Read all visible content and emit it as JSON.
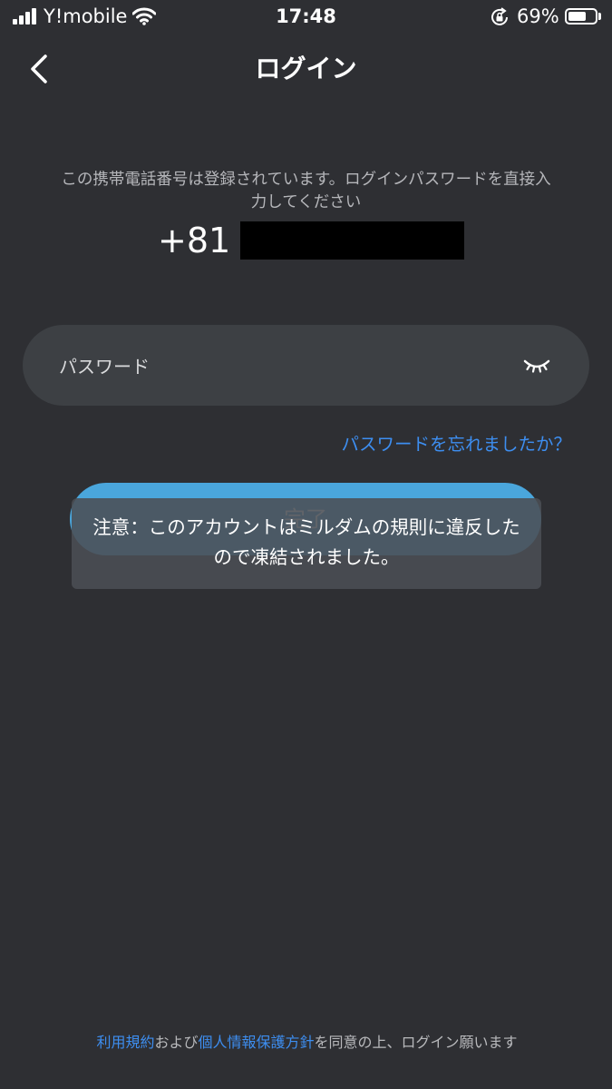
{
  "status_bar": {
    "carrier": "Y!mobile",
    "time": "17:48",
    "battery_percent": "69%",
    "battery_level": 0.69,
    "icons": [
      "signal-icon",
      "wifi-icon",
      "rotation-lock-icon",
      "battery-icon"
    ]
  },
  "header": {
    "title": "ログイン",
    "back_icon": "chevron-left-icon"
  },
  "notice": {
    "message": "この携帯電話番号は登録されています。ログインパスワードを直接入力してください",
    "country_code": "+81"
  },
  "password": {
    "placeholder": "パスワード",
    "value": "",
    "toggle_icon": "eye-closed-icon"
  },
  "forgot_password": "パスワードを忘れましたか？",
  "login_button": {
    "label": "完了"
  },
  "toast": {
    "message": "注意：このアカウントはミルダムの規則に違反したので凍結されました。"
  },
  "footer": {
    "terms_link": "利用規約",
    "and": "および",
    "privacy_link": "個人情報保護方針",
    "suffix": "を同意の上、ログイン願います"
  },
  "colors": {
    "background": "#2e2f33",
    "accent_link": "#3d8ef0",
    "button": "#4aa6dc"
  }
}
